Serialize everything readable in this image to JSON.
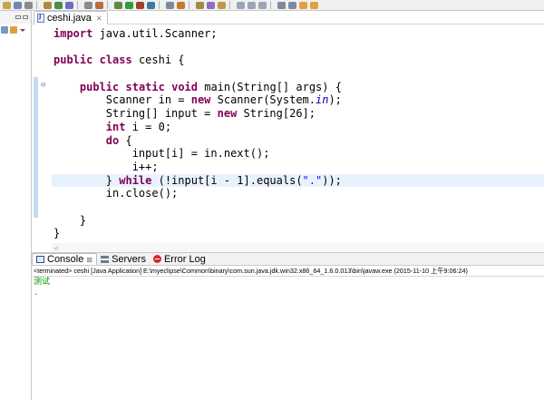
{
  "editor": {
    "tab": {
      "label": "ceshi.java",
      "close_icon": "close-icon"
    },
    "lines": [
      [
        {
          "t": "import",
          "c": "kw"
        },
        {
          "t": " java.util.Scanner;"
        }
      ],
      [],
      [
        {
          "t": "public",
          "c": "kw"
        },
        {
          "t": " "
        },
        {
          "t": "class",
          "c": "kw"
        },
        {
          "t": " ceshi {"
        }
      ],
      [],
      [
        {
          "t": "    "
        },
        {
          "t": "public",
          "c": "kw"
        },
        {
          "t": " "
        },
        {
          "t": "static",
          "c": "kw"
        },
        {
          "t": " "
        },
        {
          "t": "void",
          "c": "kw"
        },
        {
          "t": " main(String[] args) {"
        }
      ],
      [
        {
          "t": "        Scanner in = "
        },
        {
          "t": "new",
          "c": "kw"
        },
        {
          "t": " Scanner(System."
        },
        {
          "t": "in",
          "c": "fld"
        },
        {
          "t": ");"
        }
      ],
      [
        {
          "t": "        String[] input = "
        },
        {
          "t": "new",
          "c": "kw"
        },
        {
          "t": " String[26];"
        }
      ],
      [
        {
          "t": "        "
        },
        {
          "t": "int",
          "c": "kw"
        },
        {
          "t": " i = 0;"
        }
      ],
      [
        {
          "t": "        "
        },
        {
          "t": "do",
          "c": "kw"
        },
        {
          "t": " {"
        }
      ],
      [
        {
          "t": "            input[i] = in.next();"
        }
      ],
      [
        {
          "t": "            i++;"
        }
      ],
      [
        {
          "t": "        } "
        },
        {
          "t": "while",
          "c": "kw"
        },
        {
          "t": " (!input[i - 1].equals("
        },
        {
          "t": "\".\"",
          "c": "str"
        },
        {
          "t": "));"
        }
      ],
      [
        {
          "t": "        in.close();"
        }
      ],
      [],
      [
        {
          "t": "    }"
        }
      ],
      [
        {
          "t": "}"
        }
      ]
    ],
    "current_line_index": 11,
    "fold_marker": "⊖"
  },
  "console": {
    "tabs": [
      {
        "label": "Console",
        "icon": "console-icon",
        "active": true,
        "close": "⊠"
      },
      {
        "label": "Servers",
        "icon": "servers-icon",
        "active": false
      },
      {
        "label": "Error Log",
        "icon": "error-log-icon",
        "active": false
      }
    ],
    "description": "<terminated> ceshi [Java Application] E:\\myeclipse\\Common\\binary\\com.sun.java.jdk.win32.x86_64_1.6.0.013\\bin\\javaw.exe (2015-11-10 上午9:06:24)",
    "output": [
      "测试",
      "."
    ],
    "output_color": "#009900"
  },
  "colors": {
    "keyword": "#7f0055",
    "string": "#2a00ff",
    "field": "#0000c0",
    "current_line": "#e8f2fe",
    "fold_bar": "#c6dbf7"
  }
}
